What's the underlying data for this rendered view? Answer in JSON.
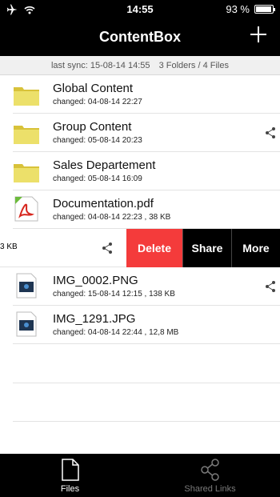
{
  "status_bar": {
    "time": "14:55",
    "battery": "93 %",
    "battery_level": 0.93
  },
  "nav": {
    "title": "ContentBox",
    "add_icon": "plus-icon"
  },
  "sync": {
    "last_sync": "last sync: 15-08-14  14:55",
    "summary": "3 Folders / 4 Files"
  },
  "items": [
    {
      "name": "Global Content",
      "meta": "changed: 04-08-14  22:27",
      "type": "folder",
      "shared": false
    },
    {
      "name": "Group Content",
      "meta": "changed: 05-08-14  20:23",
      "type": "folder",
      "shared": true
    },
    {
      "name": "Sales Departement",
      "meta": "changed: 05-08-14  16:09",
      "type": "folder",
      "shared": false
    },
    {
      "name": "Documentation.pdf",
      "meta": "changed: 04-08-14  22:23 , 38 KB",
      "type": "pdf",
      "shared": false
    },
    {
      "name": "IMG_0002.PNG",
      "meta": "changed: 15-08-14  12:15 , 138 KB",
      "type": "image",
      "shared": true
    },
    {
      "name": "IMG_1291.JPG",
      "meta": "changed: 04-08-14  22:44 , 12,8 MB",
      "type": "image",
      "shared": false
    }
  ],
  "swiped_row": {
    "size_fragment": "3 KB",
    "delete_label": "Delete",
    "share_label": "Share",
    "more_label": "More"
  },
  "tabs": [
    {
      "label": "Files",
      "icon": "file-icon",
      "active": true
    },
    {
      "label": "Shared Links",
      "icon": "share-icon",
      "active": false
    }
  ],
  "colors": {
    "delete": "#f43b3b",
    "folder": "#e8d44d",
    "bar": "#000000"
  }
}
